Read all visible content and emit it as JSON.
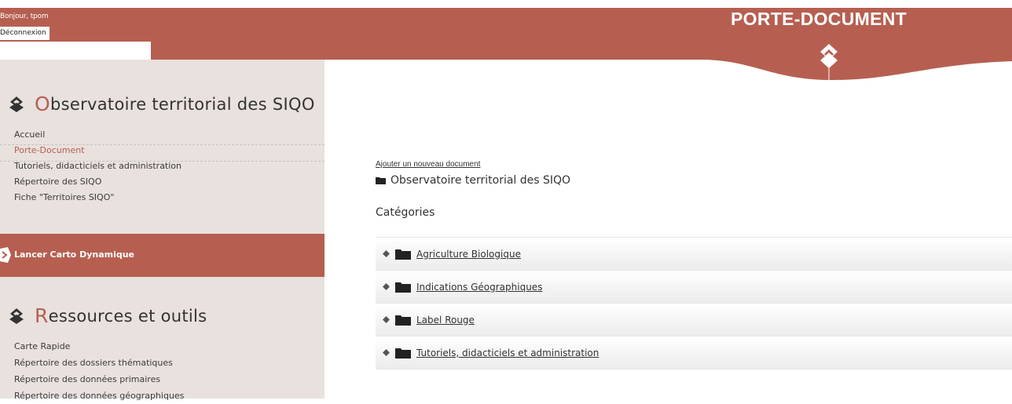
{
  "header": {
    "greeting": "Bonjour, tpom",
    "logout_label": "Déconnexion",
    "page_title": "PORTE-DOCUMENT",
    "brand_color": "#b65f51"
  },
  "sidebar": {
    "section1": {
      "initial": "O",
      "rest": "bservatoire territorial des SIQO"
    },
    "nav": [
      {
        "label": "Accueil"
      },
      {
        "label": "Porte-Document"
      },
      {
        "label": "Tutoriels, didacticiels et administration"
      },
      {
        "label": "Répertoire des SIQO"
      },
      {
        "label": "Fiche \"Territoires SIQO\""
      }
    ],
    "carto_label": "Lancer Carto Dynamique",
    "section2": {
      "initial": "R",
      "rest": "essources et outils"
    },
    "tools": [
      {
        "label": "Carte Rapide"
      },
      {
        "label": "Répertoire des dossiers thématiques"
      },
      {
        "label": "Répertoire des données primaires"
      },
      {
        "label": "Répertoire des données géographiques"
      }
    ]
  },
  "main": {
    "add_document": "Ajouter un nouveau document",
    "breadcrumb": "Observatoire territorial des SIQO",
    "categories_heading": "Catégories",
    "categories": [
      {
        "label": "Agriculture Biologique"
      },
      {
        "label": "Indications Géographiques"
      },
      {
        "label": "Label Rouge"
      },
      {
        "label": "Tutoriels, didacticiels et administration"
      }
    ]
  }
}
